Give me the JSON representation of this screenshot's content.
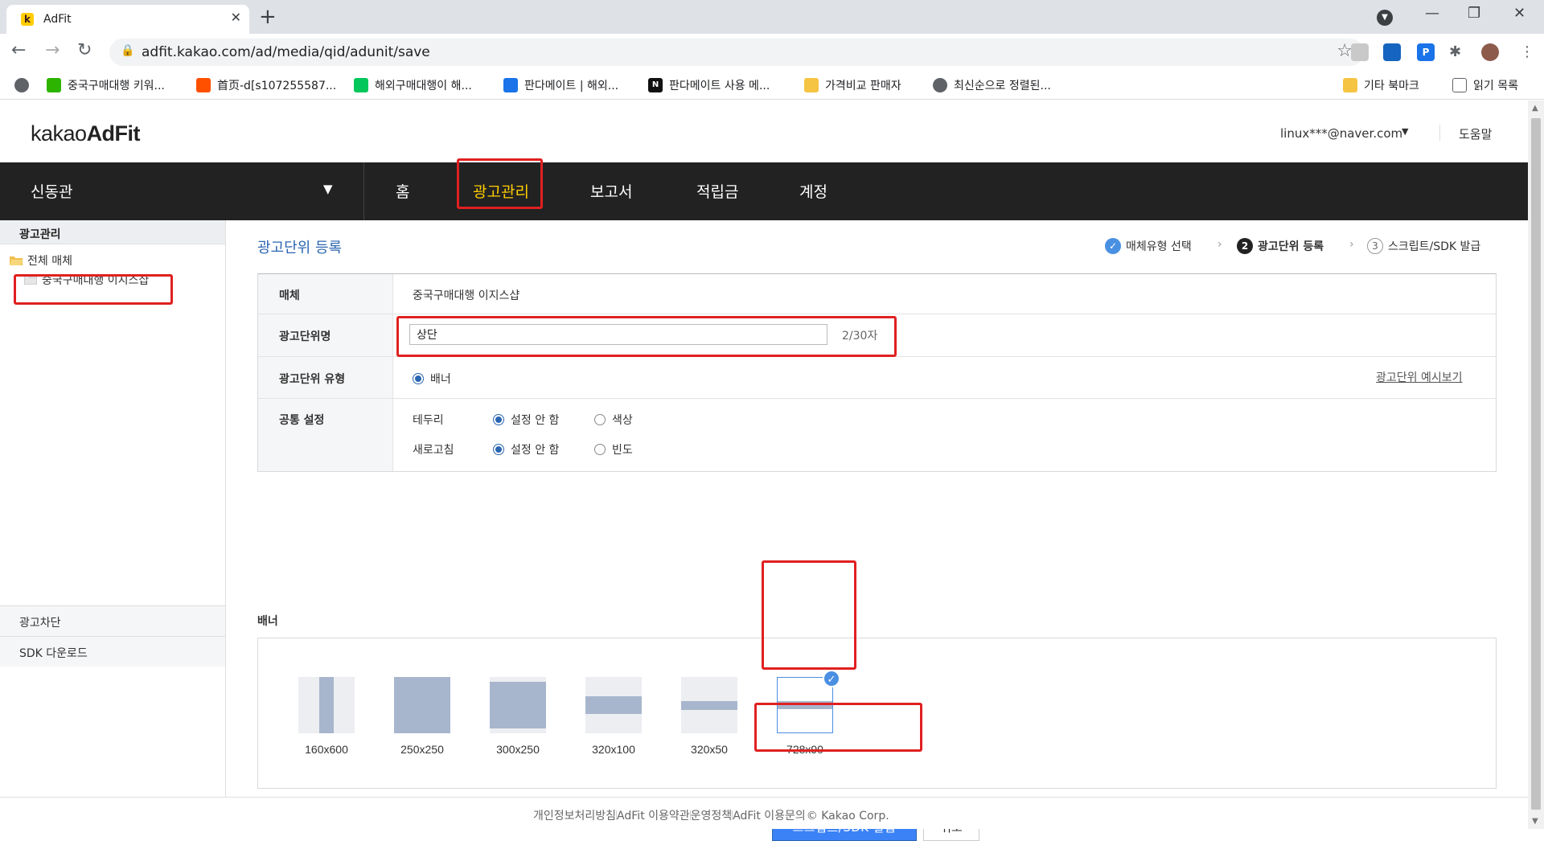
{
  "browser": {
    "tab_title": "AdFit",
    "tab_favicon_letter": "k",
    "url": "adfit.kakao.com/ad/media/qid/adunit/save",
    "bookmarks": [
      {
        "label": "중국구매대행 키워...",
        "color": "#2db400"
      },
      {
        "label": "首页-d[s107255587...",
        "color": "#ff5000"
      },
      {
        "label": "해외구매대행이 해...",
        "color": "#03c75a"
      },
      {
        "label": "판다메이트 | 해외...",
        "color": "#1a73e8"
      },
      {
        "label": "판다메이트 사용 메...",
        "color": "#111111"
      },
      {
        "label": "가격비교 판매자",
        "color": "#f6c443"
      },
      {
        "label": "최신순으로 정렬된...",
        "color": "#5f6368"
      }
    ],
    "other_bookmarks": "기타 북마크",
    "reading_list": "읽기 목록"
  },
  "header": {
    "logo_prefix": "kakao",
    "logo_bold": "AdFit",
    "user": "linux***@naver.com",
    "help": "도움말"
  },
  "gnb": {
    "media": "신동관",
    "items": [
      "홈",
      "광고관리",
      "보고서",
      "적립금",
      "계정"
    ],
    "active_index": 1
  },
  "lnb": {
    "title": "광고관리",
    "tree_root": "전체 매체",
    "tree_child": "중국구매대행 이지스샵",
    "blocks": [
      "광고차단",
      "SDK 다운로드"
    ]
  },
  "main": {
    "title": "광고단위 등록",
    "steps": [
      {
        "num": "✓",
        "label": "매체유형 선택",
        "state": "done"
      },
      {
        "num": "2",
        "label": "광고단위 등록",
        "state": "current"
      },
      {
        "num": "3",
        "label": "스크립트/SDK 발급",
        "state": "todo"
      }
    ],
    "form": {
      "media_label": "매체",
      "media_value": "중국구매대행 이지스샵",
      "name_label": "광고단위명",
      "name_value": "상단",
      "name_counter": "2/30자",
      "type_label": "광고단위 유형",
      "type_value": "배너",
      "preview_link": "광고단위 예시보기",
      "common_label": "공통 설정",
      "border_label": "테두리",
      "border_opt1": "설정 안 함",
      "border_opt2": "색상",
      "refresh_label": "새로고침",
      "refresh_opt1": "설정 안 함",
      "refresh_opt2": "빈도"
    },
    "banner_section_label": "배너",
    "banner_sizes": [
      {
        "label": "160x600",
        "selected": false
      },
      {
        "label": "250x250",
        "selected": false
      },
      {
        "label": "300x250",
        "selected": false
      },
      {
        "label": "320x100",
        "selected": false
      },
      {
        "label": "320x50",
        "selected": false
      },
      {
        "label": "728x90",
        "selected": true
      }
    ],
    "issue_button": "스크립트/SDK 발급",
    "cancel_button": "취소"
  },
  "footer": {
    "links": [
      "개인정보처리방침",
      "AdFit 이용약관",
      "운영정책",
      "AdFit 이용문의"
    ],
    "copyright": "© Kakao Corp."
  },
  "colors": {
    "accent_blue": "#2b66b1",
    "gnb_bg": "#222222",
    "gnb_active": "#ffcd00",
    "highlight_red": "#e02020"
  }
}
